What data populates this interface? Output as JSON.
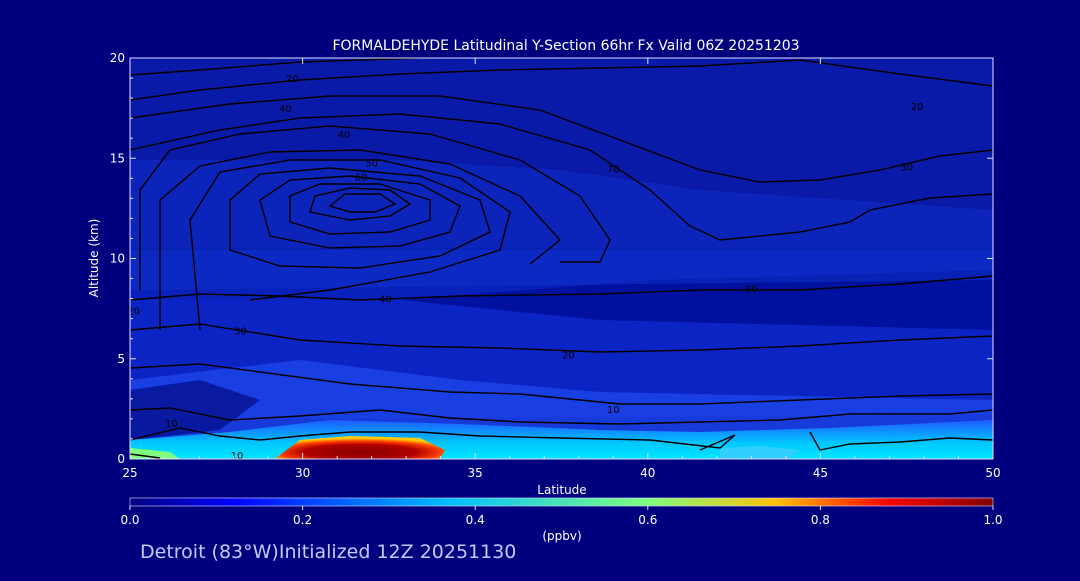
{
  "chart_data": {
    "type": "heatmap",
    "title": "FORMALDEHYDE Latitudinal Y-Section 66hr  Fx Valid 06Z 20251203",
    "xlabel": "Latitude",
    "ylabel": "Altitude (km)",
    "xlim": [
      25,
      50
    ],
    "ylim": [
      0,
      20
    ],
    "x_ticks": [
      25,
      30,
      35,
      40,
      45,
      50
    ],
    "y_ticks": [
      0,
      5,
      10,
      15,
      20
    ],
    "colorbar": {
      "label": "(ppbv)",
      "range": [
        0.0,
        1.0
      ],
      "ticks": [
        "0.0",
        "0.2",
        "0.4",
        "0.6",
        "0.8",
        "1.0"
      ],
      "colors": [
        "#00007f",
        "#0000ff",
        "#00bfff",
        "#7fff7f",
        "#ffbf00",
        "#ff0000",
        "#7f0000"
      ]
    },
    "colored_field": [
      {
        "name": "surface layer",
        "lat": [
          25,
          50
        ],
        "alt": [
          0,
          1.0
        ],
        "value": 0.35
      },
      {
        "name": "surface maximum",
        "lat": [
          29.5,
          34
        ],
        "alt": [
          0,
          0.6
        ],
        "value": 1.0
      },
      {
        "name": "mid troposphere",
        "lat": [
          25,
          50
        ],
        "alt": [
          1.0,
          10
        ],
        "value": 0.12
      },
      {
        "name": "upper troposphere",
        "lat": [
          25,
          50
        ],
        "alt": [
          10,
          20
        ],
        "value": 0.06
      }
    ],
    "contours": {
      "style": "black lines",
      "labels": [
        {
          "text": "20",
          "lat": 29.7,
          "alt": 19.0
        },
        {
          "text": "40",
          "lat": 29.5,
          "alt": 17.5
        },
        {
          "text": "40",
          "lat": 31.2,
          "alt": 16.2
        },
        {
          "text": "50",
          "lat": 32.0,
          "alt": 14.8
        },
        {
          "text": "60",
          "lat": 31.7,
          "alt": 14.1
        },
        {
          "text": "70",
          "lat": 39.0,
          "alt": 14.5
        },
        {
          "text": "20",
          "lat": 47.8,
          "alt": 17.6
        },
        {
          "text": "30",
          "lat": 47.5,
          "alt": 14.6
        },
        {
          "text": "40",
          "lat": 32.4,
          "alt": 8.0
        },
        {
          "text": "30",
          "lat": 43.0,
          "alt": 8.5
        },
        {
          "text": "30",
          "lat": 28.2,
          "alt": 6.4
        },
        {
          "text": "20",
          "lat": 37.7,
          "alt": 5.2
        },
        {
          "text": "10",
          "lat": 39.0,
          "alt": 2.5
        },
        {
          "text": "10",
          "lat": 26.2,
          "alt": 1.8
        },
        {
          "text": "10",
          "lat": 28.1,
          "alt": 0.2
        },
        {
          "text": "20",
          "lat": 25.1,
          "alt": 7.4
        }
      ]
    }
  },
  "caption": "Detroit (83°W)Initialized 12Z 20251130"
}
